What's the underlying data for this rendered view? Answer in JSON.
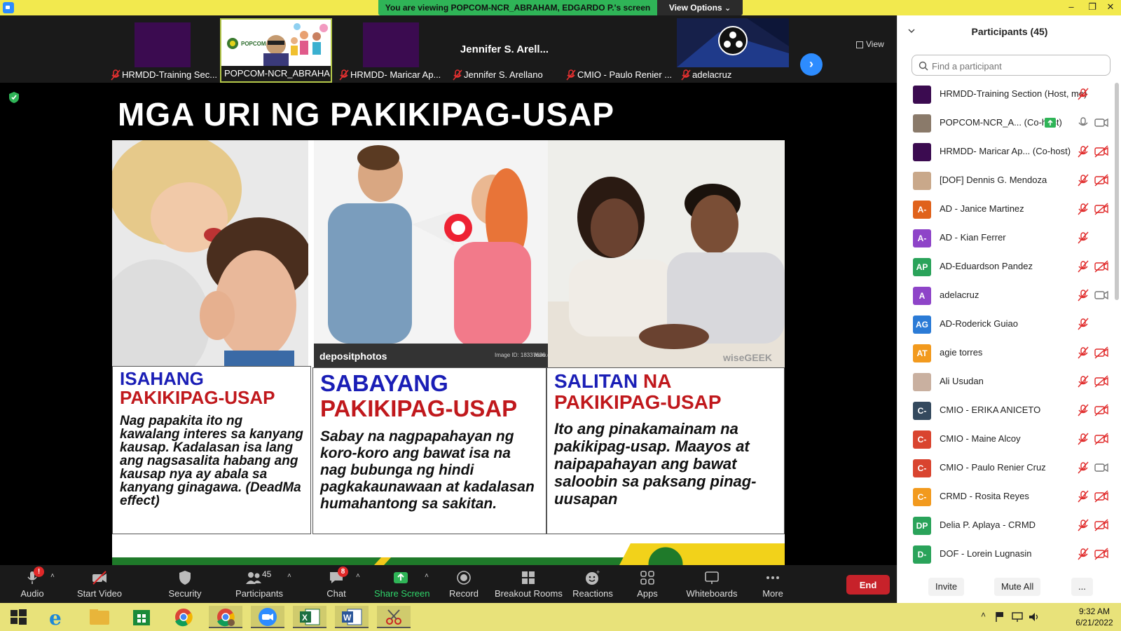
{
  "window": {
    "viewing_banner": "You are viewing POPCOM-NCR_ABRAHAM, EDGARDO P.'s screen",
    "view_options": "View Options",
    "view_options_caret": "⌄",
    "minimize": "–",
    "maximize": "❐",
    "close": "✕"
  },
  "strip": {
    "view_label": "View",
    "thumbs": [
      {
        "label": "HRMDD-Training Sec..."
      },
      {
        "label": "POPCOM-NCR_ABRAHA...",
        "logo_text": "POPCOM"
      },
      {
        "label": "HRMDD- Maricar Ap..."
      },
      {
        "label": "Jennifer S. Arellano",
        "big_name": "Jennifer S. Arell..."
      },
      {
        "label": "CMIO - Paulo Renier ..."
      },
      {
        "label": "adelacruz"
      }
    ],
    "next_arrow": "›"
  },
  "slide": {
    "title": "MGA URI NG PAKIKIPAG-USAP",
    "photo_watermark_2": "depositphotos",
    "photo_caption_2": "Image ID: 18337636",
    "photo_caption_2_site": "www.dep",
    "photo_watermark_3": "wiseGEEK",
    "cards": [
      {
        "title_line1": "ISAHANG",
        "title_line2": "PAKIKIPAG-USAP",
        "body": "Nag papakita ito ng kawalang interes sa kanyang kausap. Kadalasan isa lang ang nagsasalita habang ang kausap nya ay abala sa kanyang ginagawa. (DeadMa effect)"
      },
      {
        "title_line1": "SABAYANG",
        "title_line2": "PAKIKIPAG-USAP",
        "body": "Sabay na nagpapahayan ng koro-koro ang bawat isa na nag bubunga ng hindi pagkakaunawaan  at kadalasan humahantong sa sakitan."
      },
      {
        "title_line1a": "SALITAN",
        "title_line1b": " NA",
        "title_line2": "PAKIKIPAG-USAP",
        "body": "Ito ang pinakamainam na pakikipag-usap. Maayos at naipapahayan ang bawat saloobin sa paksang pinag-uusapan"
      }
    ]
  },
  "participants_panel": {
    "title": "Participants (45)",
    "search_placeholder": "Find a participant",
    "participants": [
      {
        "name": "HRMDD-Training Section (Host, me)",
        "initials": "",
        "color": "#3b0b50",
        "mic": "muted",
        "cam": "none"
      },
      {
        "name": "POPCOM-NCR_A...  (Co-host)",
        "initials": "",
        "color": "#8a7a6a",
        "mic": "on",
        "cam": "on",
        "share_badge": true
      },
      {
        "name": "HRMDD- Maricar Ap...  (Co-host)",
        "initials": "",
        "color": "#3b0b50",
        "mic": "muted",
        "cam": "off"
      },
      {
        "name": "[DOF] Dennis G. Mendoza",
        "initials": "",
        "color": "#c9a88a",
        "mic": "muted",
        "cam": "off"
      },
      {
        "name": "AD - Janice Martinez",
        "initials": "A-",
        "color": "#e0621b",
        "mic": "muted",
        "cam": "off"
      },
      {
        "name": "AD - Kian Ferrer",
        "initials": "A-",
        "color": "#8e44c8",
        "mic": "muted",
        "cam": "none"
      },
      {
        "name": "AD-Eduardson Pandez",
        "initials": "AP",
        "color": "#2aa35a",
        "mic": "muted",
        "cam": "off"
      },
      {
        "name": "adelacruz",
        "initials": "A",
        "color": "#8e44c8",
        "mic": "muted",
        "cam": "on"
      },
      {
        "name": "AD-Roderick Guiao",
        "initials": "AG",
        "color": "#2b7bd6",
        "mic": "muted",
        "cam": "none"
      },
      {
        "name": "agie torres",
        "initials": "AT",
        "color": "#f29a1e",
        "mic": "muted",
        "cam": "off"
      },
      {
        "name": "Ali Usudan",
        "initials": "",
        "color": "#c9b0a0",
        "mic": "muted",
        "cam": "off"
      },
      {
        "name": "CMIO - ERIKA ANICETO",
        "initials": "C-",
        "color": "#34495e",
        "mic": "muted",
        "cam": "off"
      },
      {
        "name": "CMIO - Maine Alcoy",
        "initials": "C-",
        "color": "#d9442f",
        "mic": "muted",
        "cam": "off"
      },
      {
        "name": "CMIO - Paulo Renier Cruz",
        "initials": "C-",
        "color": "#d9442f",
        "mic": "muted",
        "cam": "on"
      },
      {
        "name": "CRMD - Rosita Reyes",
        "initials": "C-",
        "color": "#f29a1e",
        "mic": "muted",
        "cam": "off"
      },
      {
        "name": "Delia P. Aplaya - CRMD",
        "initials": "DP",
        "color": "#2aa35a",
        "mic": "muted",
        "cam": "off"
      },
      {
        "name": "DOF - Lorein Lugnasin",
        "initials": "D-",
        "color": "#2aa35a",
        "mic": "muted",
        "cam": "off"
      }
    ],
    "invite": "Invite",
    "mute_all": "Mute All",
    "more": "..."
  },
  "toolbar": {
    "audio": "Audio",
    "start_video": "Start Video",
    "security": "Security",
    "participants": "Participants",
    "participants_count": "45",
    "chat": "Chat",
    "chat_badge": "8",
    "audio_badge": "!",
    "share_screen": "Share Screen",
    "record": "Record",
    "breakout_rooms": "Breakout Rooms",
    "reactions": "Reactions",
    "apps": "Apps",
    "whiteboards": "Whiteboards",
    "more": "More",
    "end": "End",
    "caret": "˄"
  },
  "taskbar": {
    "time": "9:32 AM",
    "date": "6/21/2022",
    "tray_up": "˄"
  },
  "colors": {
    "share_green": "#2fb457",
    "accent_blue": "#2d8cff",
    "end_red": "#c7222a",
    "title_yellow": "#f2e94e"
  }
}
